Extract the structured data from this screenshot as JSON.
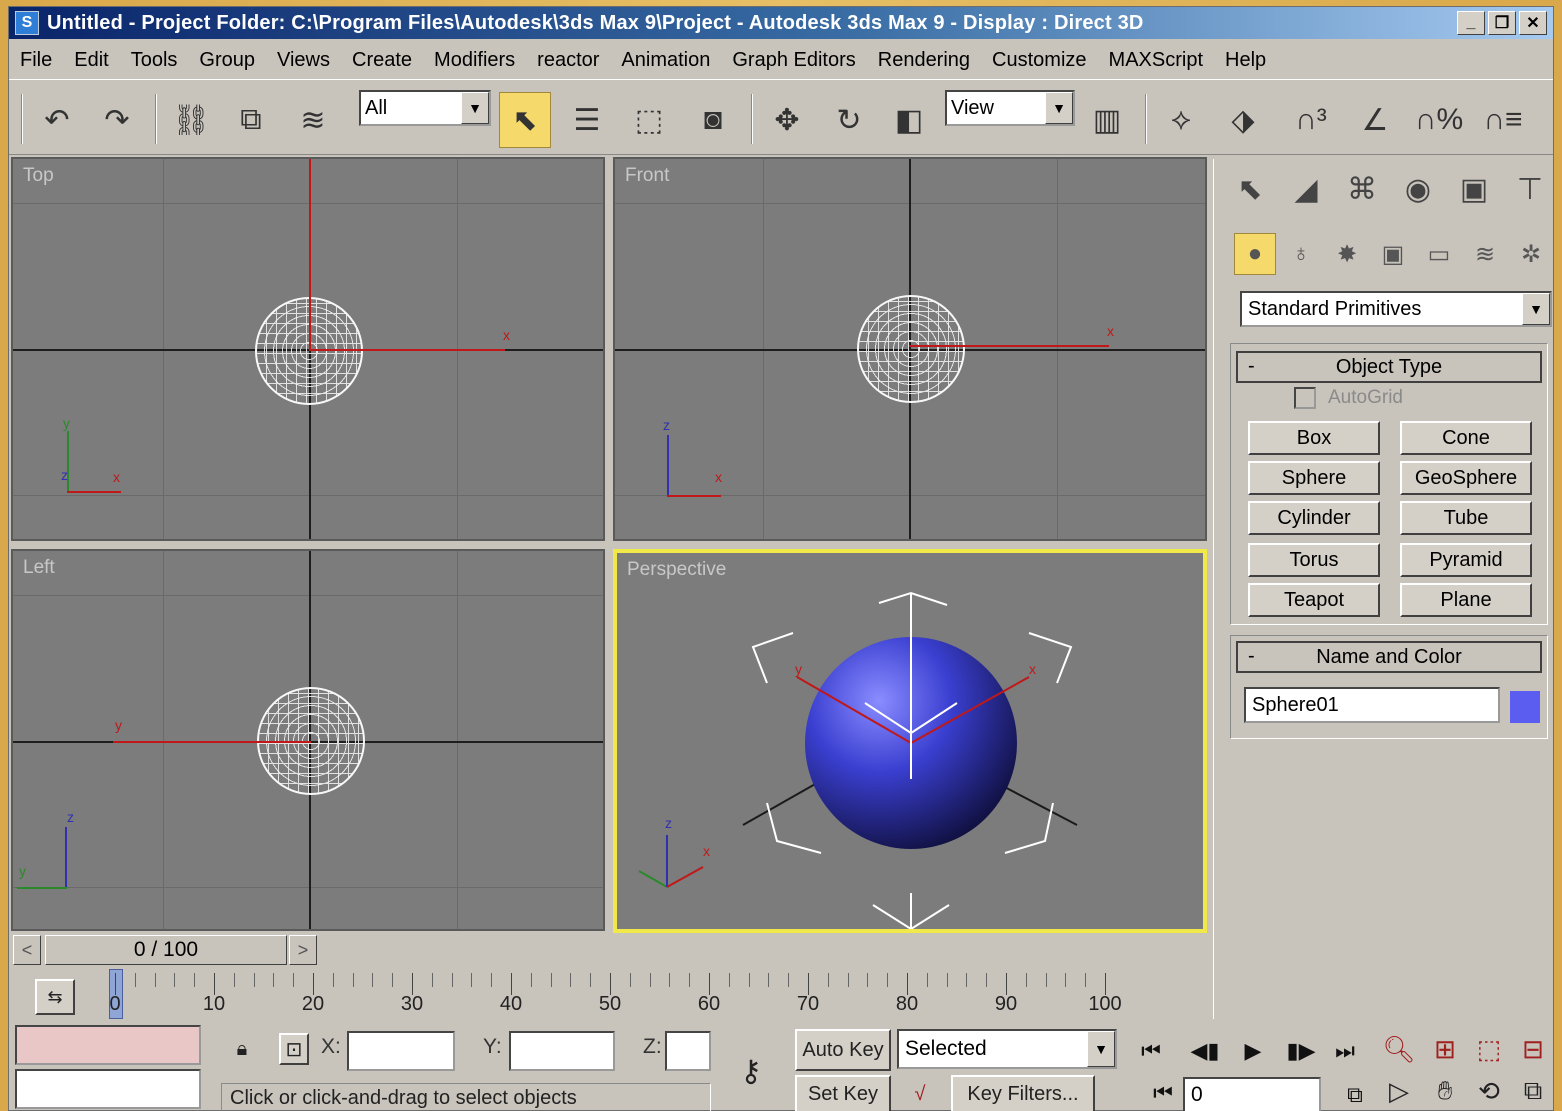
{
  "window": {
    "title": "Untitled    - Project Folder: C:\\Program Files\\Autodesk\\3ds Max 9\\Project    - Autodesk 3ds Max 9      - Display : Direct 3D",
    "controls": {
      "minimize": "_",
      "maximize": "❐",
      "close": "✕"
    }
  },
  "menu": [
    "File",
    "Edit",
    "Tools",
    "Group",
    "Views",
    "Create",
    "Modifiers",
    "reactor",
    "Animation",
    "Graph Editors",
    "Rendering",
    "Customize",
    "MAXScript",
    "Help"
  ],
  "toolbar": {
    "selection_filter": "All",
    "reference_coord": "View"
  },
  "viewports": {
    "top": {
      "label": "Top",
      "axis_x": "x",
      "axis_y": "y",
      "axis_z": "z"
    },
    "front": {
      "label": "Front",
      "axis_x": "x",
      "axis_z": "z"
    },
    "left": {
      "label": "Left",
      "axis_y": "y",
      "axis_z": "z"
    },
    "perspective": {
      "label": "Perspective",
      "axis_x": "x",
      "axis_y": "y",
      "axis_z": "z"
    }
  },
  "command_panel": {
    "category_dropdown": "Standard Primitives",
    "object_type": {
      "title": "Object Type",
      "collapse": "-",
      "autogrid": "AutoGrid",
      "buttons": [
        "Box",
        "Cone",
        "Sphere",
        "GeoSphere",
        "Cylinder",
        "Tube",
        "Torus",
        "Pyramid",
        "Teapot",
        "Plane"
      ]
    },
    "name_and_color": {
      "title": "Name and Color",
      "collapse": "-",
      "name": "Sphere01",
      "color": "#5b5cf0"
    }
  },
  "timeline": {
    "slider_text": "0 / 100",
    "prev": "<",
    "next": ">",
    "tick_labels": [
      "0",
      "10",
      "20",
      "30",
      "40",
      "50",
      "60",
      "70",
      "80",
      "90",
      "100"
    ]
  },
  "status": {
    "x_label": "X:",
    "y_label": "Y:",
    "z_label": "Z:",
    "prompt": "Click or click-and-drag to select objects",
    "auto_key": "Auto Key",
    "set_key": "Set Key",
    "selected": "Selected",
    "key_filters": "Key Filters...",
    "frame": "0"
  },
  "colors": {
    "active_viewport_border": "#f1e84a",
    "active_tool": "#f6d96b",
    "axis_red": "#c01818",
    "sphere_blue": "#3a3fd0"
  }
}
